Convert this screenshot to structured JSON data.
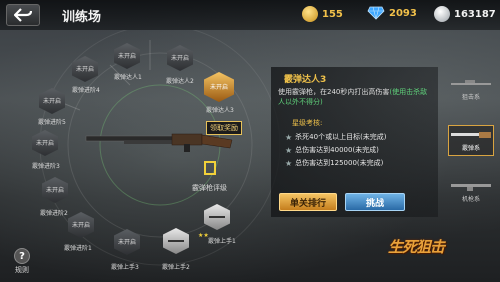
{
  "header": {
    "title": "训练场",
    "gold": "155",
    "diamond": "2093",
    "silver": "163187"
  },
  "nodes": [
    {
      "id": "n1",
      "label": "未开启",
      "caption": "霰弹达人1"
    },
    {
      "id": "n2",
      "label": "未开启",
      "caption": "霰弹达人2"
    },
    {
      "id": "n3",
      "label": "未开启",
      "caption": "霰弹达人3"
    },
    {
      "id": "n4",
      "label": "未开启",
      "caption": "霰弹进阶4"
    },
    {
      "id": "n5",
      "label": "未开启",
      "caption": "霰弹进阶5"
    },
    {
      "id": "n6",
      "label": "未开启",
      "caption": "霰弹进阶3"
    },
    {
      "id": "n7",
      "label": "未开启",
      "caption": "霰弹进阶2"
    },
    {
      "id": "n8",
      "label": "未开启",
      "caption": "霰弹进阶1"
    },
    {
      "id": "n9",
      "label": "未开启",
      "caption": "霰弹上手3"
    },
    {
      "id": "n10",
      "label": "",
      "caption": "霰弹上手2"
    },
    {
      "id": "n11",
      "label": "",
      "caption": "霰弹上手1"
    }
  ],
  "center": {
    "claim": "领取奖励",
    "assessment": "霰弹枪评级"
  },
  "detail": {
    "title": "霰弹达人3",
    "desc_pre": "使用霰弹枪，在240秒内打出高伤害",
    "desc_hl": "(使用击杀敌人以外不得分)",
    "req_title": "星级考核:",
    "reqs": [
      "杀死40个或以上目标(未完成)",
      "总伤害达到40000(未完成)",
      "总伤害达到125000(未完成)"
    ]
  },
  "buttons": {
    "rank": "单关排行",
    "challenge": "挑战"
  },
  "side": {
    "sniper": "狙击系",
    "shotgun": "霰弹系",
    "mg": "机枪系"
  },
  "logo": "生死狙击",
  "rules": "规则"
}
